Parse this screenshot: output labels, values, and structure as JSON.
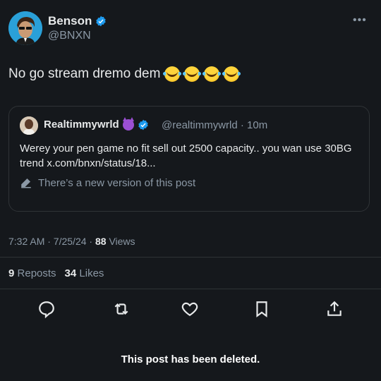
{
  "author": {
    "name": "Benson",
    "handle": "@BNXN",
    "verified": true
  },
  "post": {
    "text": "No go stream dremo dem",
    "emojis": [
      "face-with-tears-of-joy",
      "face-with-tears-of-joy",
      "face-with-tears-of-joy",
      "face-with-tears-of-joy"
    ]
  },
  "quote": {
    "name": "Realtimmywrld",
    "badge_icon": "smiling-devil-emoji",
    "verified": true,
    "handle_time": "@realtimmywrld · 10m",
    "text": "Werey your pen game no fit sell out 2500 capacity.. you wan use 30BG trend x.com/bnxn/status/18...",
    "version_notice": "There’s a new version of this post"
  },
  "meta": {
    "time_date": "7:32 AM · 7/25/24 ·",
    "views_count": "88",
    "views_label": "Views"
  },
  "stats": {
    "reposts_count": "9",
    "reposts_label": "Reposts",
    "likes_count": "34",
    "likes_label": "Likes"
  },
  "actions": [
    "reply-icon",
    "repost-icon",
    "like-icon",
    "bookmark-icon",
    "share-icon"
  ],
  "footer": {
    "deleted_notice": "This post has been deleted."
  },
  "colors": {
    "background": "#15181c",
    "text": "#e7e9ea",
    "muted": "#8b98a5",
    "verified": "#1d9bf0",
    "border": "#2f3336"
  }
}
